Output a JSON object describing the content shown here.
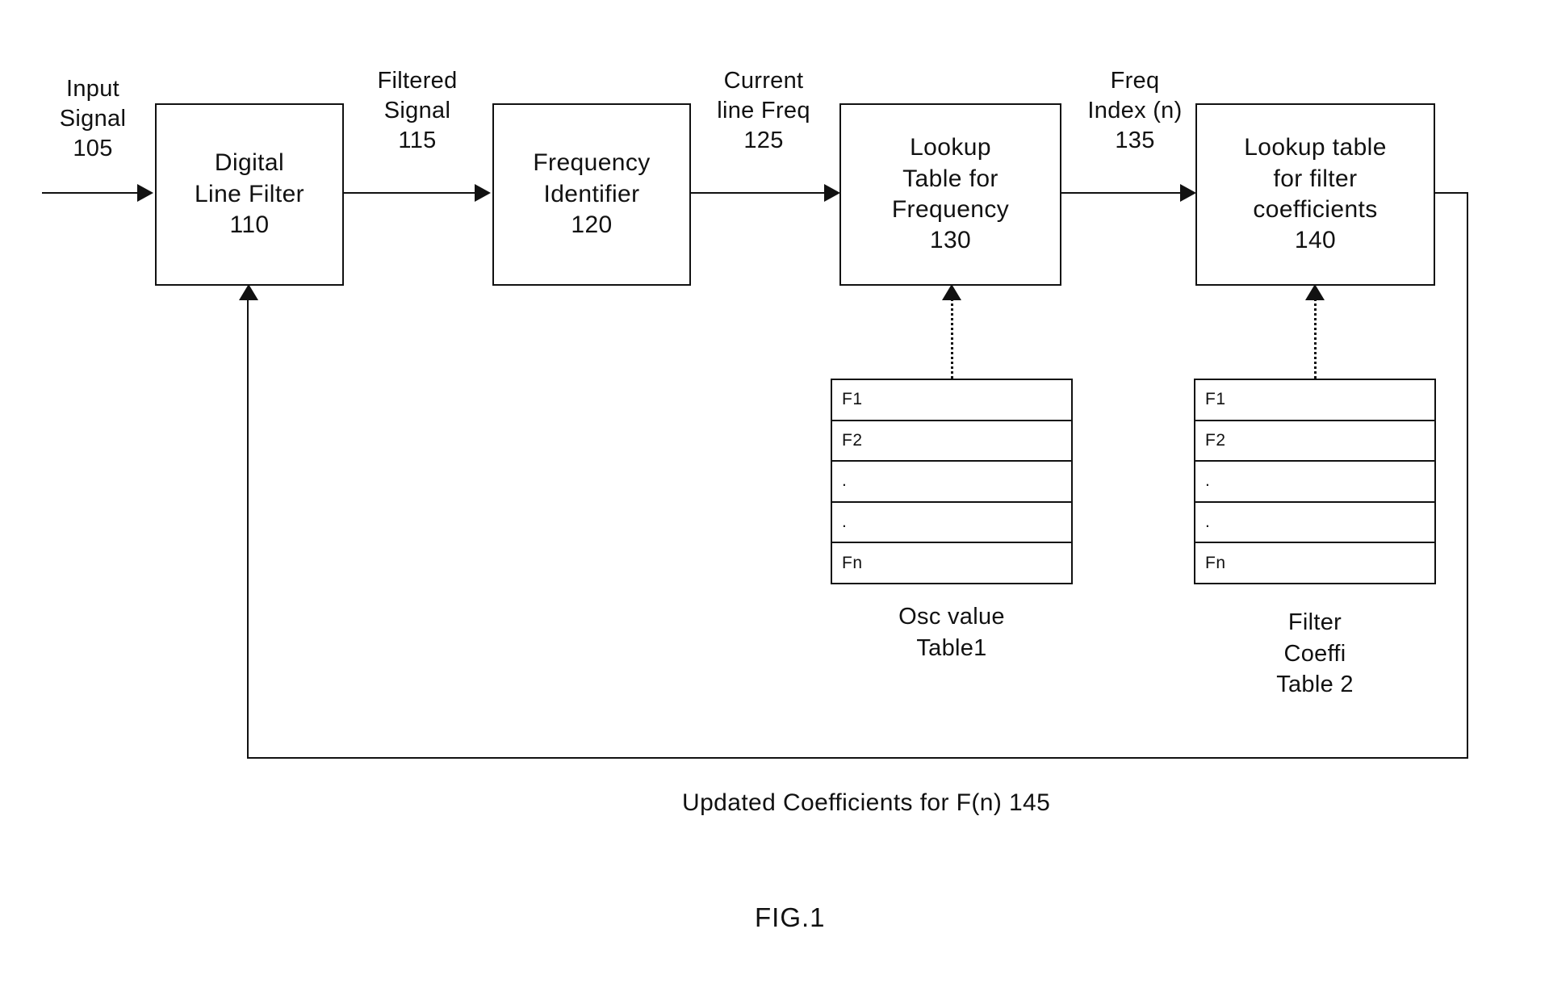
{
  "figure": {
    "caption": "FIG.1"
  },
  "blocks": [
    {
      "id": "digital-line-filter",
      "line1": "Digital",
      "line2": "Line Filter",
      "ref": "110"
    },
    {
      "id": "frequency-identifier",
      "line1": "Frequency",
      "line2": "Identifier",
      "ref": "120"
    },
    {
      "id": "lookup-table-frequency",
      "line1": "Lookup",
      "line2": "Table for",
      "line3": "Frequency",
      "ref": "130"
    },
    {
      "id": "lookup-table-filter-coefficients",
      "line1": "Lookup table",
      "line2": "for filter",
      "line3": "coefficients",
      "ref": "140"
    }
  ],
  "edge_labels": [
    {
      "id": "input-signal",
      "line1": "Input",
      "line2": "Signal",
      "ref": "105"
    },
    {
      "id": "filtered-signal",
      "line1": "Filtered",
      "line2": "Signal",
      "ref": "115"
    },
    {
      "id": "current-line-freq",
      "line1": "Current",
      "line2": "line Freq",
      "ref": "125"
    },
    {
      "id": "freq-index",
      "line1": "Freq",
      "line2": "Index (n)",
      "ref": "135"
    }
  ],
  "tables": [
    {
      "id": "osc-value-table",
      "rows": [
        "F1",
        "F2",
        ".",
        ".",
        "Fn"
      ],
      "caption_line1": "Osc value",
      "caption_line2": "Table1"
    },
    {
      "id": "filter-coeff-table",
      "rows": [
        "F1",
        "F2",
        ".",
        ".",
        "Fn"
      ],
      "caption_line1": "Filter",
      "caption_line2": "Coeffi",
      "caption_line3": "Table 2"
    }
  ],
  "feedback": {
    "label": "Updated Coefficients for F(n) 145"
  },
  "colors": {
    "ink": "#111111",
    "background": "#ffffff"
  }
}
